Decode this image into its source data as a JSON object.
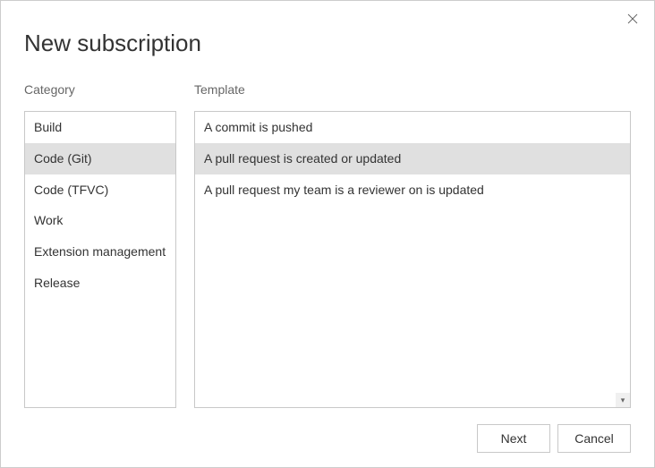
{
  "dialog": {
    "title": "New subscription",
    "close_label": "Close"
  },
  "category": {
    "label": "Category",
    "items": [
      {
        "label": "Build",
        "selected": false
      },
      {
        "label": "Code (Git)",
        "selected": true
      },
      {
        "label": "Code (TFVC)",
        "selected": false
      },
      {
        "label": "Work",
        "selected": false
      },
      {
        "label": "Extension management",
        "selected": false
      },
      {
        "label": "Release",
        "selected": false
      }
    ]
  },
  "template": {
    "label": "Template",
    "items": [
      {
        "label": "A commit is pushed",
        "selected": false
      },
      {
        "label": "A pull request is created or updated",
        "selected": true
      },
      {
        "label": "A pull request my team is a reviewer on is updated",
        "selected": false
      }
    ]
  },
  "footer": {
    "next_label": "Next",
    "cancel_label": "Cancel"
  }
}
